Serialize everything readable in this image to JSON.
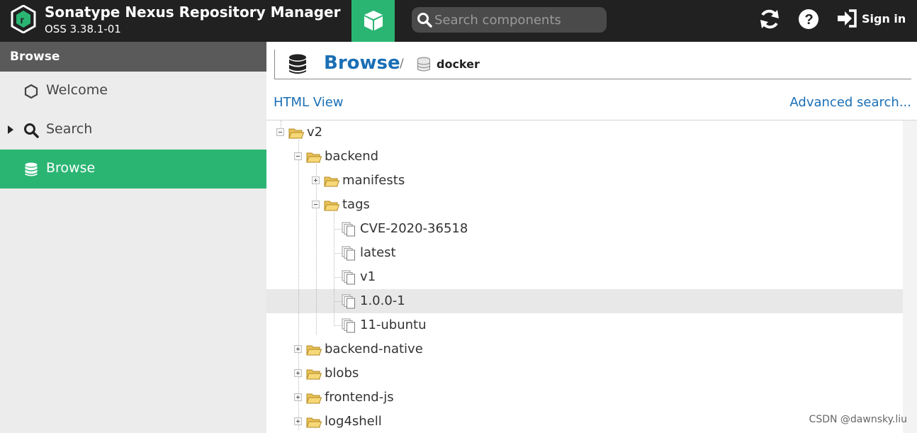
{
  "header": {
    "app_title": "Sonatype Nexus Repository Manager",
    "app_version": "OSS 3.38.1-01",
    "search_placeholder": "Search components",
    "signin_label": "Sign in",
    "colors": {
      "bar": "#212121",
      "accent": "#2bb573"
    }
  },
  "sidebar": {
    "title": "Browse",
    "items": [
      {
        "label": "Welcome",
        "icon": "hexagon-icon"
      },
      {
        "label": "Search",
        "icon": "search-icon"
      },
      {
        "label": "Browse",
        "icon": "database-icon",
        "active": true
      }
    ]
  },
  "main": {
    "breadcrumb_title": "Browse",
    "breadcrumb_sep": "/",
    "breadcrumb_sub": "docker",
    "html_view_link": "HTML View",
    "advanced_search_link": "Advanced search...",
    "tree": [
      {
        "label": "v2",
        "type": "folder",
        "expanded": true
      },
      {
        "label": "backend",
        "type": "folder",
        "expanded": true
      },
      {
        "label": "manifests",
        "type": "folder",
        "expanded": false
      },
      {
        "label": "tags",
        "type": "folder",
        "expanded": true
      },
      {
        "label": "CVE-2020-36518",
        "type": "component"
      },
      {
        "label": "latest",
        "type": "component"
      },
      {
        "label": "v1",
        "type": "component"
      },
      {
        "label": "1.0.0-1",
        "type": "component",
        "selected": true
      },
      {
        "label": "11-ubuntu",
        "type": "component"
      },
      {
        "label": "backend-native",
        "type": "folder",
        "expanded": false
      },
      {
        "label": "blobs",
        "type": "folder",
        "expanded": false
      },
      {
        "label": "frontend-js",
        "type": "folder",
        "expanded": false
      },
      {
        "label": "log4shell",
        "type": "folder",
        "expanded": false
      }
    ]
  },
  "watermark": "CSDN @dawnsky.liu"
}
